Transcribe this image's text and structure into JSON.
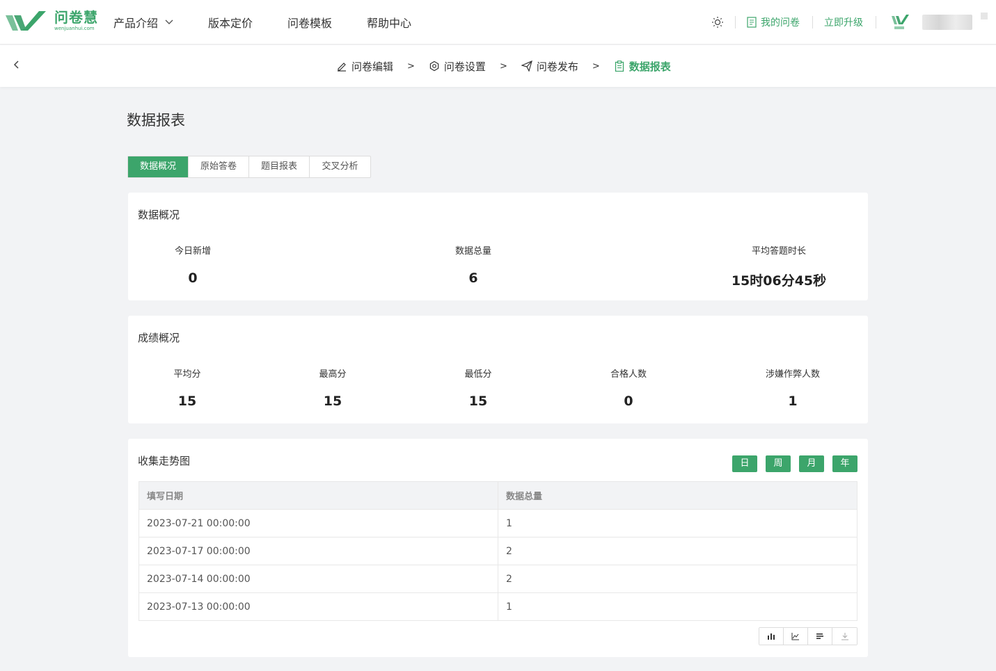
{
  "brand": {
    "name": "问卷慧",
    "domain": "wenjuanhui.com",
    "small_logo_text": "问卷慧"
  },
  "nav": {
    "items": [
      {
        "label": "产品介绍",
        "has_dropdown": true
      },
      {
        "label": "版本定价"
      },
      {
        "label": "问卷模板"
      },
      {
        "label": "帮助中心"
      }
    ]
  },
  "toolbar": {
    "my_surveys": "我的问卷",
    "upgrade": "立即升级"
  },
  "steps": {
    "items": [
      {
        "label": "问卷编辑",
        "icon": "edit-icon"
      },
      {
        "label": "问卷设置",
        "icon": "settings-icon"
      },
      {
        "label": "问卷发布",
        "icon": "send-icon"
      },
      {
        "label": "数据报表",
        "icon": "clipboard-icon",
        "active": true
      }
    ],
    "separator": ">"
  },
  "page": {
    "title": "数据报表"
  },
  "tabs": [
    {
      "label": "数据概况",
      "active": true
    },
    {
      "label": "原始答卷"
    },
    {
      "label": "题目报表"
    },
    {
      "label": "交叉分析"
    }
  ],
  "overview": {
    "title": "数据概况",
    "stats": [
      {
        "label": "今日新增",
        "value": "0"
      },
      {
        "label": "数据总量",
        "value": "6"
      },
      {
        "label": "平均答题时长",
        "value": "15时06分45秒"
      }
    ]
  },
  "scores": {
    "title": "成绩概况",
    "stats": [
      {
        "label": "平均分",
        "value": "15"
      },
      {
        "label": "最高分",
        "value": "15"
      },
      {
        "label": "最低分",
        "value": "15"
      },
      {
        "label": "合格人数",
        "value": "0"
      },
      {
        "label": "涉嫌作弊人数",
        "value": "1"
      }
    ]
  },
  "trend": {
    "title": "收集走势图",
    "periods": [
      "日",
      "周",
      "月",
      "年"
    ],
    "columns": [
      "填写日期",
      "数据总量"
    ],
    "rows": [
      [
        "2023-07-21 00:00:00",
        "1"
      ],
      [
        "2023-07-17 00:00:00",
        "2"
      ],
      [
        "2023-07-14 00:00:00",
        "2"
      ],
      [
        "2023-07-13 00:00:00",
        "1"
      ]
    ]
  },
  "colors": {
    "accent": "#3ca56b",
    "background": "#f2f3f5"
  }
}
